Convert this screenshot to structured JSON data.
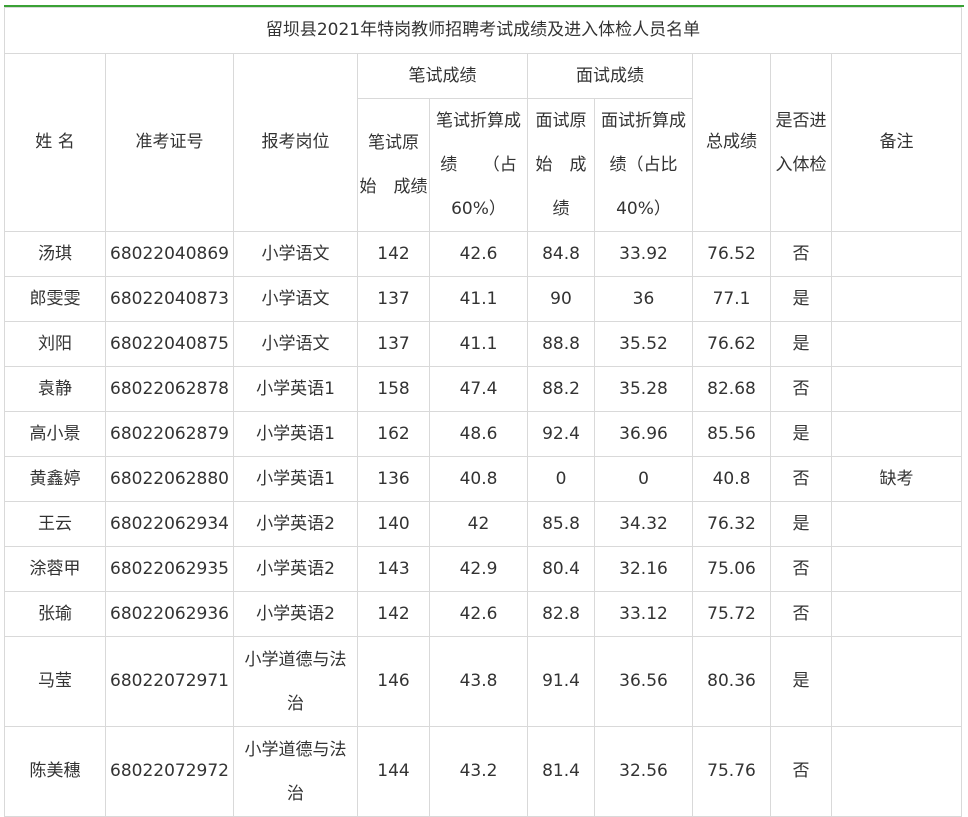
{
  "title": "留坝县2021年特岗教师招聘考试成绩及进入体检人员名单",
  "headers": {
    "name": "姓 名",
    "ticket": "准考证号",
    "position": "报考岗位",
    "written": "笔试成绩",
    "written_raw_l1": "笔试原",
    "written_raw_l2": "始　成绩",
    "written_conv_l1": "笔试折算成",
    "written_conv_l2": "绩　　（占",
    "written_conv_l3": "60%）",
    "interview": "面试成绩",
    "interview_raw_l1": "面试原",
    "interview_raw_l2": "始　成",
    "interview_raw_l3": "绩",
    "interview_conv_l1": "面试折算成",
    "interview_conv_l2": "绩（占比",
    "interview_conv_l3": "40%）",
    "total": "总成绩",
    "physical_l1": "是否进",
    "physical_l2": "入体检",
    "remark": "备注"
  },
  "rows": [
    {
      "name": "汤琪",
      "ticket": "68022040869",
      "position": "小学语文",
      "written_raw": "142",
      "written_conv": "42.6",
      "interview_raw": "84.8",
      "interview_conv": "33.92",
      "total": "76.52",
      "physical": "否",
      "remark": ""
    },
    {
      "name": "郎雯雯",
      "ticket": "68022040873",
      "position": "小学语文",
      "written_raw": "137",
      "written_conv": "41.1",
      "interview_raw": "90",
      "interview_conv": "36",
      "total": "77.1",
      "physical": "是",
      "remark": ""
    },
    {
      "name": "刘阳",
      "ticket": "68022040875",
      "position": "小学语文",
      "written_raw": "137",
      "written_conv": "41.1",
      "interview_raw": "88.8",
      "interview_conv": "35.52",
      "total": "76.62",
      "physical": "是",
      "remark": ""
    },
    {
      "name": "袁静",
      "ticket": "68022062878",
      "position": "小学英语1",
      "written_raw": "158",
      "written_conv": "47.4",
      "interview_raw": "88.2",
      "interview_conv": "35.28",
      "total": "82.68",
      "physical": "否",
      "remark": ""
    },
    {
      "name": "高小景",
      "ticket": "68022062879",
      "position": "小学英语1",
      "written_raw": "162",
      "written_conv": "48.6",
      "interview_raw": "92.4",
      "interview_conv": "36.96",
      "total": "85.56",
      "physical": "是",
      "remark": ""
    },
    {
      "name": "黄鑫婷",
      "ticket": "68022062880",
      "position": "小学英语1",
      "written_raw": "136",
      "written_conv": "40.8",
      "interview_raw": "0",
      "interview_conv": "0",
      "total": "40.8",
      "physical": "否",
      "remark": "缺考"
    },
    {
      "name": "王云",
      "ticket": "68022062934",
      "position": "小学英语2",
      "written_raw": "140",
      "written_conv": "42",
      "interview_raw": "85.8",
      "interview_conv": "34.32",
      "total": "76.32",
      "physical": "是",
      "remark": ""
    },
    {
      "name": "涂蓉甲",
      "ticket": "68022062935",
      "position": "小学英语2",
      "written_raw": "143",
      "written_conv": "42.9",
      "interview_raw": "80.4",
      "interview_conv": "32.16",
      "total": "75.06",
      "physical": "否",
      "remark": ""
    },
    {
      "name": "张瑜",
      "ticket": "68022062936",
      "position": "小学英语2",
      "written_raw": "142",
      "written_conv": "42.6",
      "interview_raw": "82.8",
      "interview_conv": "33.12",
      "total": "75.72",
      "physical": "否",
      "remark": ""
    },
    {
      "name": "马莹",
      "ticket": "68022072971",
      "position_l1": "小学道德与法",
      "position_l2": "治",
      "written_raw": "146",
      "written_conv": "43.8",
      "interview_raw": "91.4",
      "interview_conv": "36.56",
      "total": "80.36",
      "physical": "是",
      "remark": ""
    },
    {
      "name": "陈美穗",
      "ticket": "68022072972",
      "position_l1": "小学道德与法",
      "position_l2": "治",
      "written_raw": "144",
      "written_conv": "43.2",
      "interview_raw": "81.4",
      "interview_conv": "32.56",
      "total": "75.76",
      "physical": "否",
      "remark": ""
    }
  ],
  "colors": {
    "accent": "#3aa135",
    "border": "#d9d9d9",
    "text": "#333333"
  }
}
